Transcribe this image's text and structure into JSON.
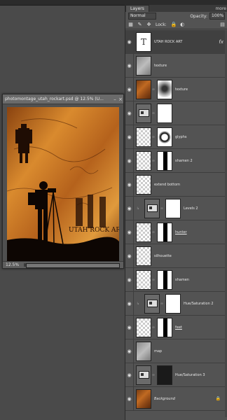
{
  "document": {
    "title": "photomontage_utah_rockart.psd @ 12.5% (U...",
    "zoom": "12.5%",
    "art_text": "UTAH ROCK ART"
  },
  "panel": {
    "tab": "Layers",
    "more": "more",
    "blend_mode": "Normal",
    "opacity_label": "Opacity:",
    "opacity_value": "100%",
    "lock_label": "Lock:"
  },
  "layers": [
    {
      "name": "UTAH ROCK ART",
      "kind": "text",
      "selected": true,
      "fx": "fx"
    },
    {
      "name": "texture",
      "kind": "pixel",
      "thumb": "grey"
    },
    {
      "name": "texture",
      "kind": "pixel-mask",
      "thumb": "rust",
      "mask": "blur"
    },
    {
      "name": "",
      "kind": "adjust-mask",
      "mask": "white"
    },
    {
      "name": "glyphs",
      "kind": "pixel-mask",
      "thumb": "checker",
      "mask": "blob"
    },
    {
      "name": "shamen 2",
      "kind": "pixel-mask",
      "thumb": "checker",
      "mask": "shape"
    },
    {
      "name": "extend bottom",
      "kind": "pixel",
      "thumb": "checker"
    },
    {
      "name": "Levels 2",
      "kind": "adjust-mask",
      "indent": true,
      "mask": "white"
    },
    {
      "name": "hunter",
      "kind": "pixel-mask",
      "thumb": "checker",
      "mask": "shape",
      "underline": true
    },
    {
      "name": "silhouette",
      "kind": "pixel",
      "thumb": "checker"
    },
    {
      "name": "shamen",
      "kind": "pixel-mask",
      "thumb": "checker",
      "mask": "shape"
    },
    {
      "name": "Hue/Saturation 2",
      "kind": "adjust-mask",
      "indent": true,
      "mask": "white"
    },
    {
      "name": "feet",
      "kind": "pixel-mask",
      "thumb": "checker",
      "mask": "shape",
      "underline": true
    },
    {
      "name": "map",
      "kind": "pixel",
      "thumb": "grey"
    },
    {
      "name": "Hue/Saturation 3",
      "kind": "adjust-mask",
      "mask": "dark"
    },
    {
      "name": "Background",
      "kind": "pixel",
      "thumb": "rust",
      "italic": true,
      "locked": true
    }
  ],
  "colors": {
    "panel": "#535353",
    "selected": "#404040",
    "accent": "#c06a22"
  }
}
